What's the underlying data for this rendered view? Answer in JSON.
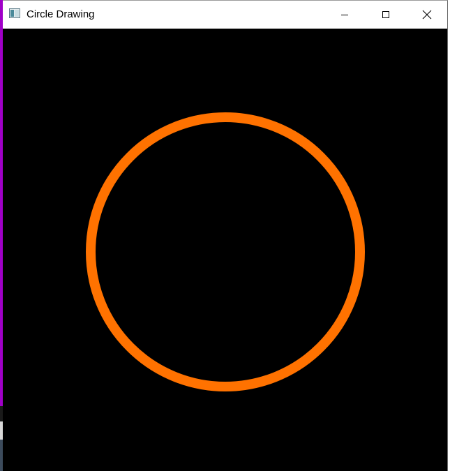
{
  "window": {
    "title": "Circle Drawing",
    "controls": {
      "minimize": "minimize-icon",
      "maximize": "maximize-icon",
      "close": "close-icon"
    }
  },
  "canvas": {
    "background_color": "#000000",
    "circle": {
      "stroke_color": "#ff7200",
      "fill": "none"
    }
  },
  "colors": {
    "desktop_accent": "#a000c8",
    "titlebar": "#ffffff"
  }
}
